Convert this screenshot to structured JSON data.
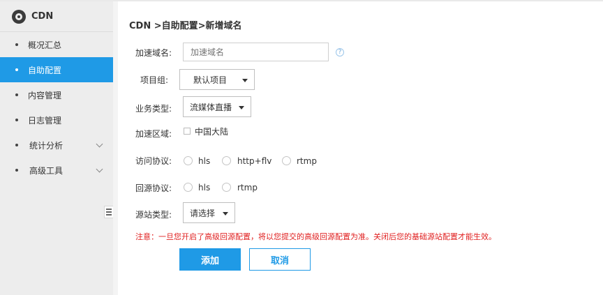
{
  "app": {
    "title": "CDN",
    "icon": "cdn-logo-icon"
  },
  "sidebar": {
    "items": [
      {
        "label": "概况汇总",
        "active": false,
        "expandable": false
      },
      {
        "label": "自助配置",
        "active": true,
        "expandable": false
      },
      {
        "label": "内容管理",
        "active": false,
        "expandable": false
      },
      {
        "label": "日志管理",
        "active": false,
        "expandable": false
      },
      {
        "label": "统计分析",
        "active": false,
        "expandable": true
      },
      {
        "label": "高级工具",
        "active": false,
        "expandable": true
      }
    ]
  },
  "breadcrumb": "CDN >自助配置>新增域名",
  "form": {
    "domain": {
      "label": "加速域名:",
      "placeholder": "加速域名",
      "value": ""
    },
    "project": {
      "label": "项目组:",
      "selected": "默认项目"
    },
    "biz_type": {
      "label": "业务类型:",
      "selected": "流媒体直播"
    },
    "region": {
      "label": "加速区域:",
      "option": "中国大陆"
    },
    "protocol": {
      "label": "访问协议:",
      "options": [
        "hls",
        "http+flv",
        "rtmp"
      ]
    },
    "origin_protocol": {
      "label": "回源协议:",
      "options": [
        "hls",
        "rtmp"
      ]
    },
    "origin_type": {
      "label": "源站类型:",
      "selected": "请选择"
    }
  },
  "notice": "注意：一旦您开启了高级回源配置，将以您提交的高级回源配置为准。关闭后您的基础源站配置才能生效。",
  "buttons": {
    "add": "添加",
    "cancel": "取消"
  },
  "colors": {
    "accent": "#1f9ae6",
    "warning": "#e02020",
    "sidebar_bg": "#ededed"
  }
}
